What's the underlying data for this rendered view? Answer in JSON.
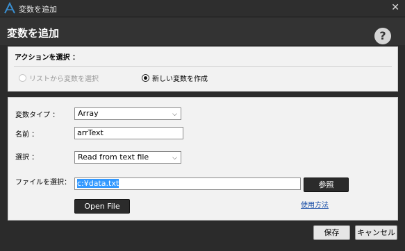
{
  "window": {
    "title": "変数を追加",
    "close_symbol": "✕"
  },
  "header": {
    "title": "変数を追加",
    "help_symbol": "?"
  },
  "action_section": {
    "label": "アクションを選択 ：",
    "options": [
      {
        "label": "リストから変数を選択",
        "selected": false,
        "enabled": false
      },
      {
        "label": "新しい変数を作成",
        "selected": true,
        "enabled": true
      }
    ]
  },
  "form": {
    "var_type_label": "変数タイプ ：",
    "var_type_value": "Array",
    "name_label": "名前 ：",
    "name_value": "arrText",
    "select_label": "選択 ：",
    "select_value": "Read from text file",
    "file_label": "ファイルを選択：",
    "file_value": "c:¥data.txt",
    "browse_label": "参照",
    "open_file_label": "Open File",
    "usage_link": "使用方法"
  },
  "footer": {
    "save_label": "保存",
    "cancel_label": "キャンセル"
  },
  "colors": {
    "dark": "#2b2b2b",
    "panel": "#f2f2f2",
    "link": "#1a4fa8",
    "selection": "#3399ff"
  }
}
